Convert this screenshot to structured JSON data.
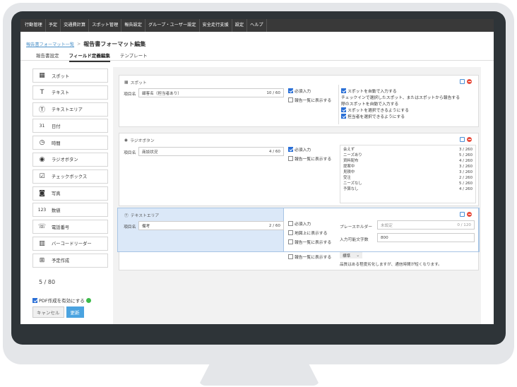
{
  "nav": [
    "行動管理",
    "予定",
    "交通費計算",
    "スポット管理",
    "報告設定",
    "グループ・ユーザー設定",
    "安全走行支援",
    "設定",
    "ヘルプ"
  ],
  "breadcrumb": {
    "link": "報告書フォーマット一覧",
    "sep": ">",
    "title": "報告書フォーマット編集"
  },
  "tabs": [
    "報告書設定",
    "フィールド定義編集",
    "テンプレート"
  ],
  "sidebar": [
    {
      "icon": "grid-icon",
      "glyph": "▦",
      "label": "スポット"
    },
    {
      "icon": "text-icon",
      "glyph": "T",
      "label": "テキスト"
    },
    {
      "icon": "textarea-icon",
      "glyph": "Ⓣ",
      "label": "テキストエリア"
    },
    {
      "icon": "calendar-icon",
      "glyph": "31",
      "label": "日付"
    },
    {
      "icon": "clock-icon",
      "glyph": "◷",
      "label": "時間"
    },
    {
      "icon": "radio-icon",
      "glyph": "◉",
      "label": "ラジオボタン"
    },
    {
      "icon": "checkbox-icon",
      "glyph": "☑",
      "label": "チェックボックス"
    },
    {
      "icon": "camera-icon",
      "glyph": "◙",
      "label": "写真"
    },
    {
      "icon": "number-icon",
      "glyph": "123",
      "label": "数値"
    },
    {
      "icon": "phone-icon",
      "glyph": "☏",
      "label": "電話番号"
    },
    {
      "icon": "barcode-icon",
      "glyph": "▥",
      "label": "バーコードリーダー"
    },
    {
      "icon": "schedule-icon",
      "glyph": "⊞",
      "label": "予定作成"
    }
  ],
  "count": "5 / 80",
  "pdf_label": "PDF作成を有効にする",
  "cancel": "キャンセル",
  "update": "更新",
  "card1": {
    "header": "スポット",
    "item_label": "項目名",
    "value": "顧客名（担当者あり）",
    "counter": "10 / 60",
    "required": "必須入力",
    "list_show": "報告一覧に表示する",
    "options": [
      "スポットを自動で入力する",
      "チェックインで選択したスポット、またはスポットから報告する",
      "際のスポットを自動で入力する",
      "スポットを選択できるようにする",
      "担当者を選択できるようにする"
    ]
  },
  "card2": {
    "header": "ラジオボタン",
    "item_label": "項目名",
    "value": "商談状況",
    "counter": "4 / 60",
    "required": "必須入力",
    "list_show": "報告一覧に表示する",
    "choices": [
      [
        "会えず",
        "3 / 260"
      ],
      [
        "ニーズあり",
        "5 / 260"
      ],
      [
        "資料配布",
        "4 / 260"
      ],
      [
        "提案中",
        "3 / 260"
      ],
      [
        "見積中",
        "3 / 260"
      ],
      [
        "受注",
        "2 / 260"
      ],
      [
        "ニーズなし",
        "5 / 260"
      ],
      [
        "予算なし",
        "4 / 260"
      ]
    ]
  },
  "card3": {
    "header": "テキストエリア",
    "item_label": "項目名",
    "value": "備考",
    "counter": "2 / 60",
    "required": "必須入力",
    "map_show": "地図上に表示する",
    "list_show": "報告一覧に表示する",
    "placeholder_label": "プレースホルダー",
    "placeholder_value": "未設定",
    "placeholder_counter": "0 / 120",
    "max_label": "入力可能文字数",
    "max_value": "800"
  },
  "card4": {
    "list_show": "報告一覧に表示する",
    "select": "標準",
    "note": "品質はある程度劣化しますが、通信時間が短くなります。"
  }
}
